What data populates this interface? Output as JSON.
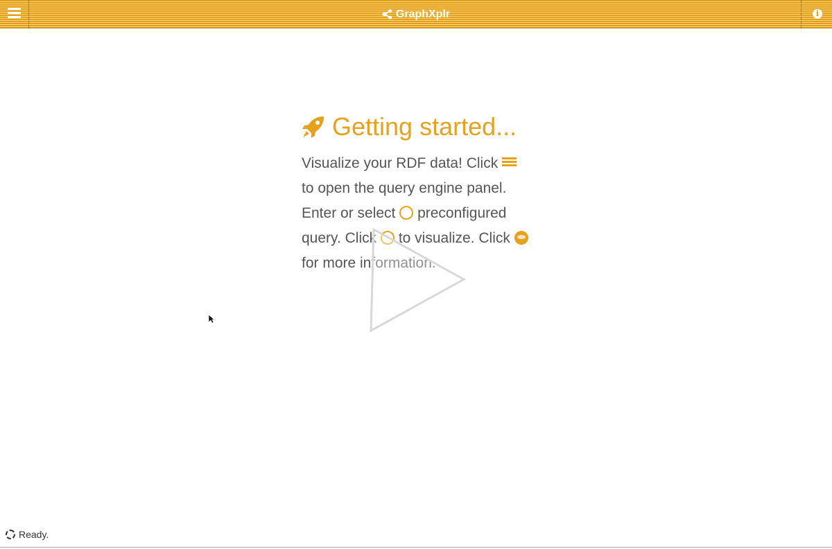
{
  "header": {
    "menu_icon": "hamburger-menu-icon",
    "brand_icon": "share-nodes-icon",
    "title": "GraphXplr",
    "info_icon": "info-icon",
    "info_glyph": "i",
    "accent": "#e39f12"
  },
  "intro": {
    "heading_icon": "rocket-icon",
    "heading": "Getting started...",
    "text_1": "Visualize your RDF data! Click ",
    "text_2": " to open the query engine panel. Enter or select ",
    "text_3": " preconfigured query. Click ",
    "text_4": " to visualize. Click ",
    "text_5": " for more information.",
    "text_color": "#555555",
    "accent": "#e4a21f"
  },
  "overlay": {
    "play_icon": "play-icon"
  },
  "status": {
    "icon": "spinner-icon",
    "text": "Ready."
  }
}
